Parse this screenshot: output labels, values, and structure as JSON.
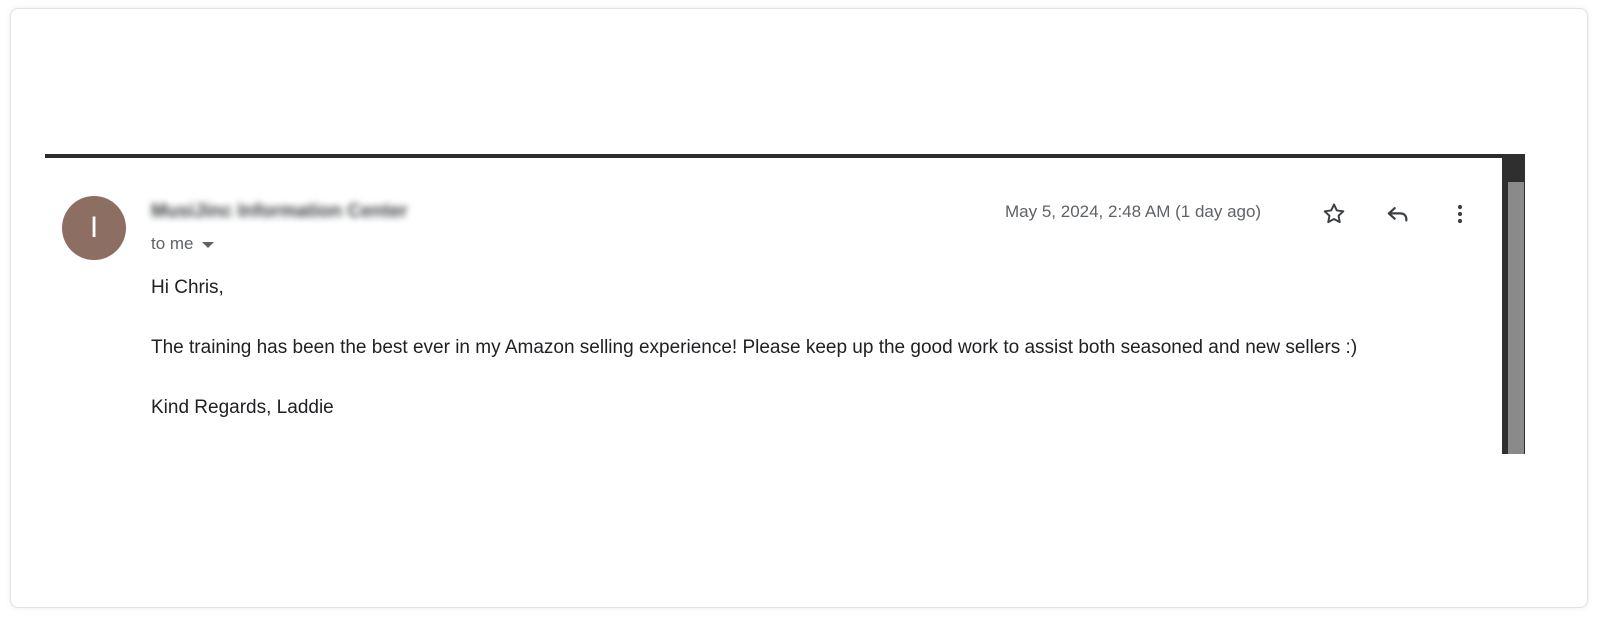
{
  "email": {
    "avatar_initial": "I",
    "avatar_color": "#8d6e63",
    "sender_name": "MusiJinc Information Center",
    "recipients_label": "to me",
    "timestamp": "May 5, 2024, 2:48 AM (1 day ago)",
    "actions": {
      "star_icon": "star-outline-icon",
      "reply_icon": "reply-icon",
      "more_icon": "more-vert-icon"
    },
    "body": {
      "greeting": "Hi Chris,",
      "message": "The training has been the best ever in my Amazon selling experience! Please keep up the good work to assist both seasoned and new sellers :)",
      "signoff": "Kind Regards, Laddie"
    }
  }
}
